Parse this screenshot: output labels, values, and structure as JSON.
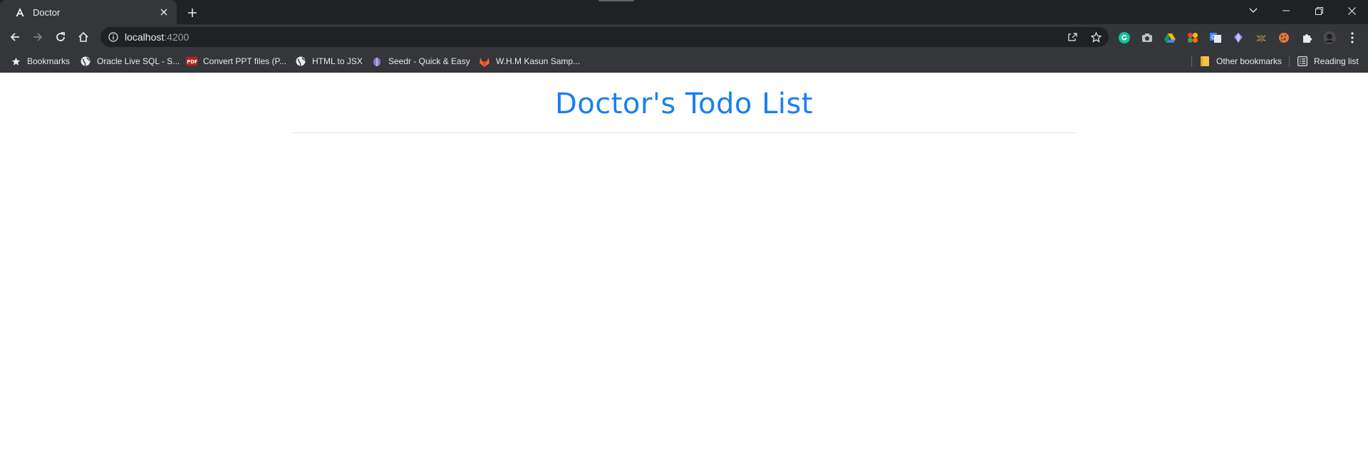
{
  "browser": {
    "tab": {
      "title": "Doctor",
      "favicon": "angular-icon"
    },
    "new_tab_icon": "plus-icon",
    "window_controls": [
      "tab-search-icon",
      "minimize-icon",
      "restore-icon",
      "close-icon"
    ],
    "address": {
      "host": "localhost",
      "port": ":4200",
      "info_icon": "info-icon"
    },
    "extensions": [
      "grammarly-icon",
      "camera-icon",
      "google-drive-icon",
      "multicolor-app-icon",
      "translate-icon",
      "crystal-icon",
      "bug-icon",
      "cookie-icon",
      "puzzle-icon",
      "profile-avatar-icon",
      "menu-dots-icon"
    ]
  },
  "bookmarks": {
    "items": [
      {
        "label": "Bookmarks",
        "icon": "star-icon"
      },
      {
        "label": "Oracle Live SQL - S...",
        "icon": "globe-icon"
      },
      {
        "label": "Convert PPT files (P...",
        "icon": "pdf-icon"
      },
      {
        "label": "HTML to JSX",
        "icon": "globe-icon"
      },
      {
        "label": "Seedr - Quick & Easy",
        "icon": "seed-icon"
      },
      {
        "label": "W.H.M Kasun Samp...",
        "icon": "gitlab-icon"
      }
    ],
    "other_bookmarks": "Other bookmarks",
    "reading_list": "Reading list"
  },
  "page": {
    "title": "Doctor's Todo List",
    "accent_color": "#1a7ff0"
  }
}
